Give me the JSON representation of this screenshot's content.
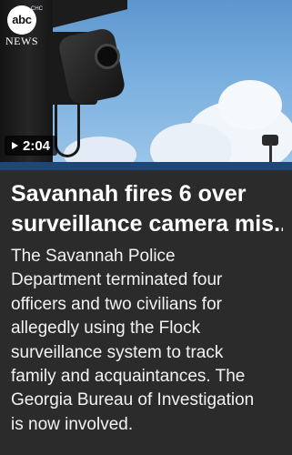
{
  "thumbnail": {
    "logo_text": "abc",
    "logo_subtext": "CHC",
    "news_label": "NEWS",
    "duration": "2:04",
    "play_icon": "play-icon"
  },
  "colors": {
    "background": "#2b2b2b",
    "accent": "#1d4679",
    "text": "#ffffff"
  },
  "article": {
    "headline_lines": [
      "Savannah fires 6 over",
      "surveillance camera mis..."
    ],
    "summary_lines": [
      "The Savannah Police",
      "Department terminated four",
      "officers and two civilians for",
      "allegedly using the Flock",
      "surveillance system to track",
      "family and acquaintances. The",
      "Georgia Bureau of Investigation",
      "is now involved."
    ]
  }
}
